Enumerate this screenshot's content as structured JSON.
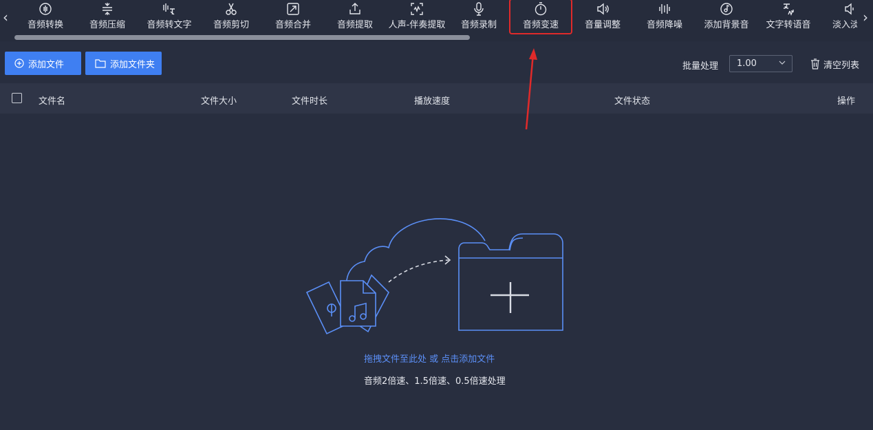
{
  "toolbar": {
    "items": [
      {
        "label": "音频转换",
        "icon": "audio-convert-icon"
      },
      {
        "label": "音频压缩",
        "icon": "compress-icon"
      },
      {
        "label": "音频转文字",
        "icon": "audio-to-text-icon"
      },
      {
        "label": "音频剪切",
        "icon": "scissors-icon"
      },
      {
        "label": "音频合并",
        "icon": "merge-icon"
      },
      {
        "label": "音频提取",
        "icon": "extract-icon"
      },
      {
        "label": "人声-伴奏提取",
        "icon": "vocal-extract-icon"
      },
      {
        "label": "音频录制",
        "icon": "microphone-icon"
      },
      {
        "label": "音频变速",
        "icon": "speed-icon"
      },
      {
        "label": "音量调整",
        "icon": "volume-icon"
      },
      {
        "label": "音频降噪",
        "icon": "denoise-icon"
      },
      {
        "label": "添加背景音",
        "icon": "music-disc-icon"
      },
      {
        "label": "文字转语音",
        "icon": "text-to-speech-icon"
      },
      {
        "label": "淡入淡出",
        "icon": "fade-icon"
      }
    ],
    "active_index": 8,
    "active_color": "#e02a2a"
  },
  "actions": {
    "add_file": "添加文件",
    "add_folder": "添加文件夹",
    "batch_label": "批量处理",
    "batch_value": "1.00",
    "clear_list": "清空列表"
  },
  "table": {
    "columns": [
      "文件名",
      "文件大小",
      "文件时长",
      "播放速度",
      "文件状态",
      "操作"
    ]
  },
  "empty_state": {
    "drop_text": "拖拽文件至此处 或 点击添加文件",
    "hint_text": "音频2倍速、1.5倍速、0.5倍速处理"
  },
  "colors": {
    "accent": "#3f7ff2",
    "background": "#282e3f",
    "link": "#5b8ff7"
  }
}
